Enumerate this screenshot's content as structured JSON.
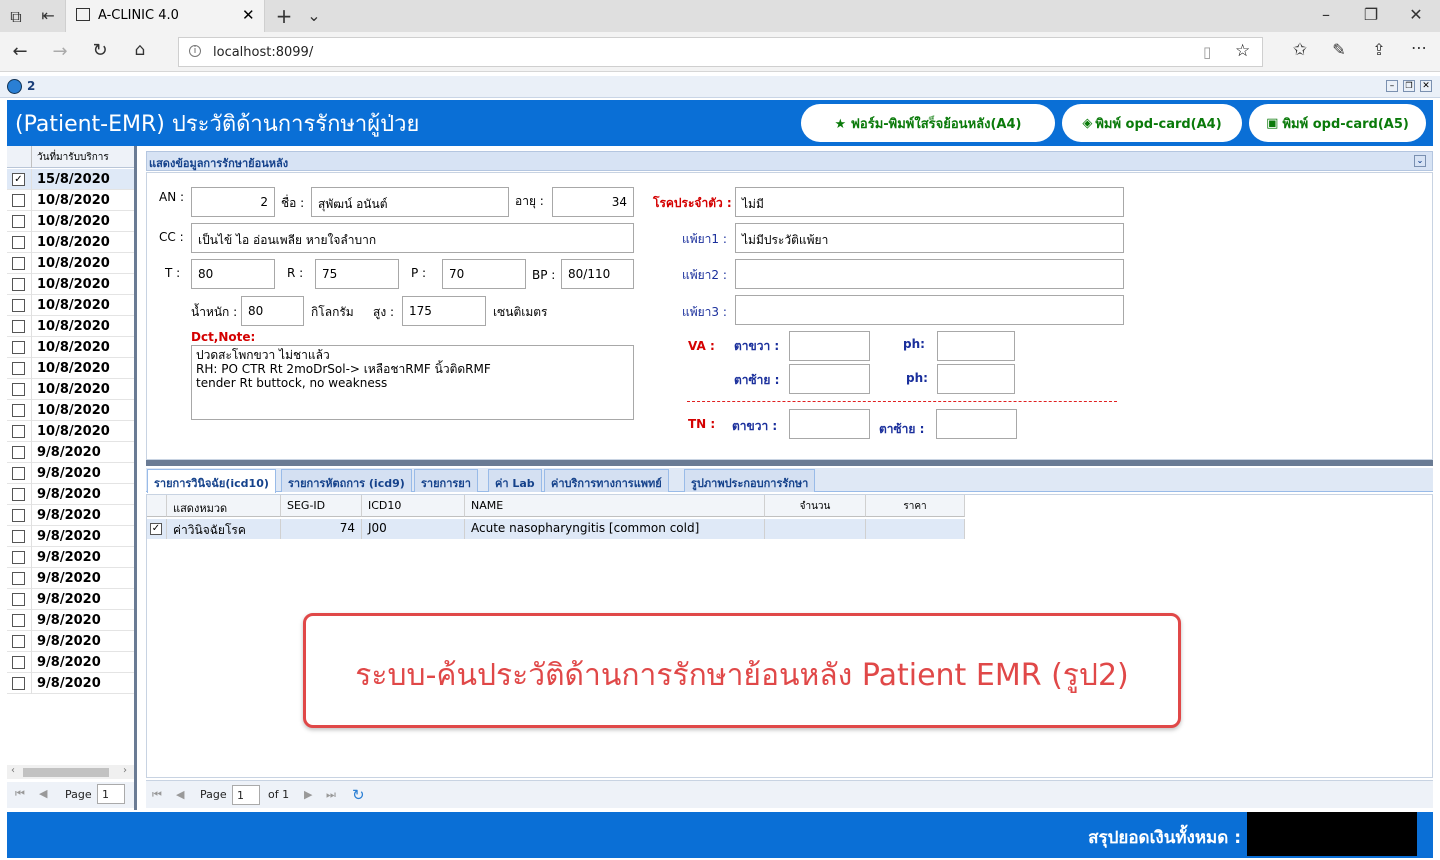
{
  "browser": {
    "tab_title": "A-CLINIC 4.0",
    "url": "localhost:8099/"
  },
  "app": {
    "window_label": "2",
    "header_title": "(Patient-EMR) ประวัติด้านการรักษาผู้ป่วย",
    "buttons": {
      "print_receipt": "★ ฟอร์ม-พิมพ์ใสร็จย้อนหลัง(A4)",
      "opd_a4": "พิมพ์ opd-card(A4)",
      "opd_a5": "พิมพ์ opd-card(A5)"
    },
    "date_list_header": "วันที่มารับบริการ",
    "dates": [
      "15/8/2020",
      "10/8/2020",
      "10/8/2020",
      "10/8/2020",
      "10/8/2020",
      "10/8/2020",
      "10/8/2020",
      "10/8/2020",
      "10/8/2020",
      "10/8/2020",
      "10/8/2020",
      "10/8/2020",
      "10/8/2020",
      "9/8/2020",
      "9/8/2020",
      "9/8/2020",
      "9/8/2020",
      "9/8/2020",
      "9/8/2020",
      "9/8/2020",
      "9/8/2020",
      "9/8/2020",
      "9/8/2020",
      "9/8/2020",
      "9/8/2020"
    ],
    "left_pager": {
      "page_label": "Page",
      "page_value": "1"
    },
    "section_title": "แสดงข้อมูลการรักษาย้อนหลัง",
    "form": {
      "an_label": "AN :",
      "an_value": "2",
      "name_label": "ชื่อ :",
      "name_value": "สุพัฒน์  อนันต์",
      "age_label": "อายุ :",
      "age_value": "34",
      "disease_label": "โรคประจำตัว :",
      "disease_value": "ไม่มี",
      "cc_label": "CC :",
      "cc_value": "เป็นไข้ ไอ อ่อนเพลีย หายใจลำบาก",
      "allergy1_label": "แพ้ยา1 :",
      "allergy1_value": "ไม่มีประวัติแพ้ยา",
      "allergy2_label": "แพ้ยา2 :",
      "allergy2_value": "",
      "allergy3_label": "แพ้ยา3 :",
      "allergy3_value": "",
      "t_label": "T :",
      "t_value": "80",
      "r_label": "R :",
      "r_value": "75",
      "p_label": "P :",
      "p_value": "70",
      "bp_label": "BP :",
      "bp_value": "80/110",
      "weight_label": "น้ำหนัก :",
      "weight_value": "80",
      "weight_unit": "กิโลกรัม",
      "height_label": "สูง :",
      "height_value": "175",
      "height_unit": "เซนติเมตร",
      "note_label": "Dct,Note:",
      "note_lines": [
        "ปวดสะโพกขวา ไม่ชาแล้ว",
        "RH: PO CTR Rt 2moDrSol-> เหลือชาRMF นิ้วติดRMF",
        "tender Rt buttock, no weakness"
      ],
      "va_label": "VA :",
      "right_eye_label": "ตาขวา :",
      "left_eye_label": "ตาซ้าย :",
      "ph_label": "ph:",
      "tn_label": "TN :"
    },
    "tabs": [
      "รายการวินิจฉัย(icd10)",
      "รายการหัตถการ (icd9)",
      "รายการยา",
      "ค่า Lab",
      "ค่าบริการทางการแพทย์",
      "รูปภาพประกอบการรักษา"
    ],
    "grid": {
      "headers": [
        "แสดงหมวด",
        "SEG-ID",
        "ICD10",
        "NAME",
        "จำนวน",
        "ราคา"
      ],
      "rows": [
        {
          "category": "ค่าวินิจฉัยโรค",
          "seg_id": "74",
          "icd10": "J00",
          "name": "Acute nasopharyngitis [common cold]",
          "qty": "",
          "price": ""
        }
      ]
    },
    "pager": {
      "page_label": "Page",
      "page_value": "1",
      "of_label": "of 1"
    },
    "callout": "ระบบ-ค้นประวัติด้านการรักษาย้อนหลัง Patient EMR  (รูป2)",
    "footer_total_label": "สรุปยอดเงินทั้งหมด :"
  },
  "colors": {
    "header_blue": "#0a6fd6",
    "accent_green": "#0a7a0a",
    "alert_red": "#e04848"
  }
}
